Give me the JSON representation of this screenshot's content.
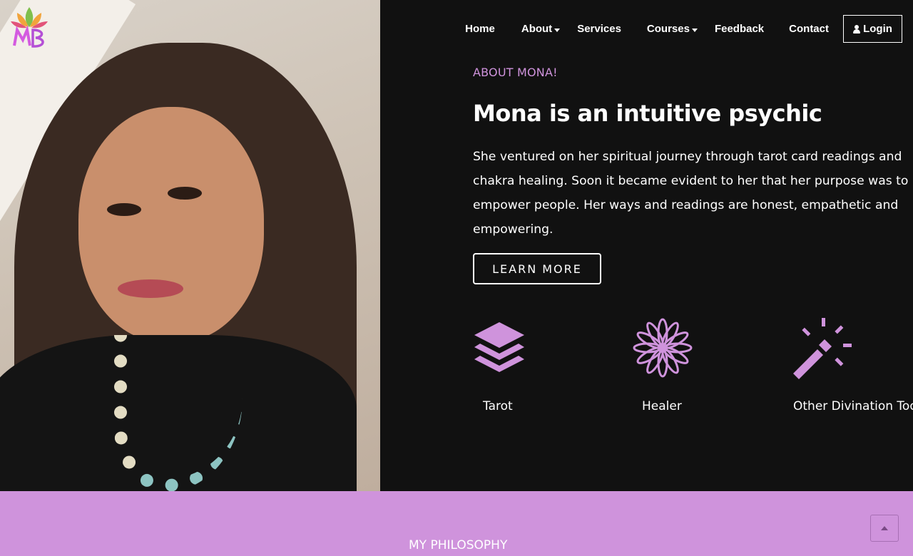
{
  "brand": {
    "logo_alt": "MB",
    "accent": "#cf93dc",
    "background": "#111111"
  },
  "nav": {
    "items": [
      {
        "label": "Home",
        "dropdown": false
      },
      {
        "label": "About",
        "dropdown": true
      },
      {
        "label": "Services",
        "dropdown": false
      },
      {
        "label": "Courses",
        "dropdown": true
      },
      {
        "label": "Feedback",
        "dropdown": false
      },
      {
        "label": "Contact",
        "dropdown": false
      }
    ],
    "login_label": "Login"
  },
  "about": {
    "eyebrow": "ABOUT MONA!",
    "headline": "Mona is an intuitive psychic",
    "paragraph": "She ventured on her spiritual journey through tarot card readings and chakra healing. Soon it became evident to her that her purpose was to empower people. Her ways and readings are honest, empathetic and empowering.",
    "cta_label": "LEARN MORE"
  },
  "features": [
    {
      "label": "Tarot",
      "icon": "layers-icon"
    },
    {
      "label": "Healer",
      "icon": "flower-icon"
    },
    {
      "label": "Other Divination Tools",
      "icon": "magic-wand-icon"
    }
  ],
  "philosophy": {
    "title": "MY PHILOSOPHY"
  }
}
